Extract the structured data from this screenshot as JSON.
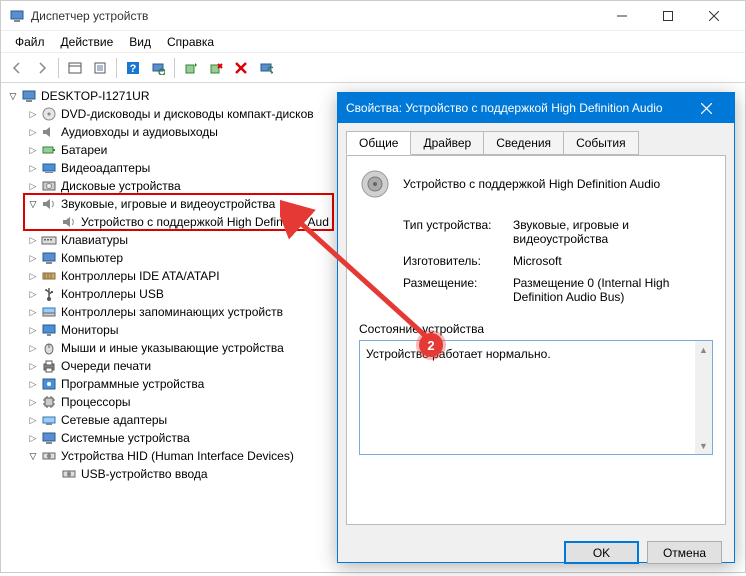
{
  "window": {
    "title": "Диспетчер устройств"
  },
  "menu": {
    "file": "Файл",
    "action": "Действие",
    "view": "Вид",
    "help": "Справка"
  },
  "tree": {
    "root": "DESKTOP-I1271UR",
    "items": [
      "DVD-дисководы и дисководы компакт-дисков",
      "Аудиовходы и аудиовыходы",
      "Батареи",
      "Видеоадаптеры",
      "Дисковые устройства",
      "Звуковые, игровые и видеоустройства",
      "Клавиатуры",
      "Компьютер",
      "Контроллеры IDE ATA/ATAPI",
      "Контроллеры USB",
      "Контроллеры запоминающих устройств",
      "Мониторы",
      "Мыши и иные указывающие устройства",
      "Очереди печати",
      "Программные устройства",
      "Процессоры",
      "Сетевые адаптеры",
      "Системные устройства",
      "Устройства HID (Human Interface Devices)"
    ],
    "sound_child": "Устройство с поддержкой High Definition Aud",
    "hid_child": "USB-устройство ввода"
  },
  "dialog": {
    "title": "Свойства: Устройство с поддержкой High Definition Audio",
    "tabs": {
      "general": "Общие",
      "driver": "Драйвер",
      "details": "Сведения",
      "events": "События"
    },
    "device_name": "Устройство с поддержкой High Definition Audio",
    "props": {
      "type_label": "Тип устройства:",
      "type_value": "Звуковые, игровые и видеоустройства",
      "mfg_label": "Изготовитель:",
      "mfg_value": "Microsoft",
      "loc_label": "Размещение:",
      "loc_value": "Размещение 0 (Internal High Definition Audio Bus)"
    },
    "status_label": "Состояние устройства",
    "status_text": "Устройство работает нормально.",
    "ok": "OK",
    "cancel": "Отмена"
  },
  "badge": "2"
}
